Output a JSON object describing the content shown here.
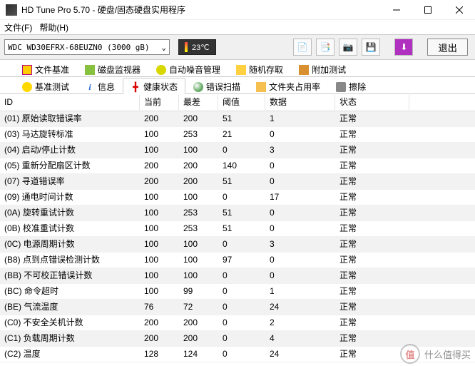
{
  "window": {
    "title": "HD Tune Pro 5.70 - 硬盘/固态硬盘实用程序"
  },
  "menus": {
    "file": "文件(F)",
    "help": "帮助(H)"
  },
  "toolbar": {
    "drive": "WDC WD30EFRX-68EUZN0 (3000 gB)",
    "temp": "23℃",
    "exit": "退出"
  },
  "tabs_row1": [
    {
      "label": "文件基准",
      "icon": "i-file"
    },
    {
      "label": "磁盘监视器",
      "icon": "i-chart"
    },
    {
      "label": "自动噪音管理",
      "icon": "i-speaker"
    },
    {
      "label": "随机存取",
      "icon": "i-card"
    },
    {
      "label": "附加测试",
      "icon": "i-clip"
    }
  ],
  "tabs_row2": [
    {
      "label": "基准测试",
      "icon": "i-bench"
    },
    {
      "label": "信息",
      "icon": "i-info",
      "glyph": "i"
    },
    {
      "label": "健康状态",
      "icon": "i-health",
      "glyph": "╋",
      "active": true
    },
    {
      "label": "错误扫描",
      "icon": "i-scan"
    },
    {
      "label": "文件夹占用率",
      "icon": "i-folder"
    },
    {
      "label": "擦除",
      "icon": "i-erase"
    }
  ],
  "columns": [
    "ID",
    "当前",
    "最差",
    "阈值",
    "数据",
    "状态"
  ],
  "rows": [
    {
      "id": "(01) 原始读取错误率",
      "cur": "200",
      "worst": "200",
      "thr": "51",
      "data": "1",
      "stat": "正常"
    },
    {
      "id": "(03) 马达旋转标准",
      "cur": "100",
      "worst": "253",
      "thr": "21",
      "data": "0",
      "stat": "正常"
    },
    {
      "id": "(04) 启动/停止计数",
      "cur": "100",
      "worst": "100",
      "thr": "0",
      "data": "3",
      "stat": "正常"
    },
    {
      "id": "(05) 重新分配扇区计数",
      "cur": "200",
      "worst": "200",
      "thr": "140",
      "data": "0",
      "stat": "正常"
    },
    {
      "id": "(07) 寻道错误率",
      "cur": "200",
      "worst": "200",
      "thr": "51",
      "data": "0",
      "stat": "正常"
    },
    {
      "id": "(09) 通电时间计数",
      "cur": "100",
      "worst": "100",
      "thr": "0",
      "data": "17",
      "stat": "正常"
    },
    {
      "id": "(0A) 旋转重试计数",
      "cur": "100",
      "worst": "253",
      "thr": "51",
      "data": "0",
      "stat": "正常"
    },
    {
      "id": "(0B) 校准重试计数",
      "cur": "100",
      "worst": "253",
      "thr": "51",
      "data": "0",
      "stat": "正常"
    },
    {
      "id": "(0C) 电源周期计数",
      "cur": "100",
      "worst": "100",
      "thr": "0",
      "data": "3",
      "stat": "正常"
    },
    {
      "id": "(B8) 点到点错误检测计数",
      "cur": "100",
      "worst": "100",
      "thr": "97",
      "data": "0",
      "stat": "正常"
    },
    {
      "id": "(BB) 不可校正错误计数",
      "cur": "100",
      "worst": "100",
      "thr": "0",
      "data": "0",
      "stat": "正常"
    },
    {
      "id": "(BC) 命令超时",
      "cur": "100",
      "worst": "99",
      "thr": "0",
      "data": "1",
      "stat": "正常"
    },
    {
      "id": "(BE) 气流温度",
      "cur": "76",
      "worst": "72",
      "thr": "0",
      "data": "24",
      "stat": "正常"
    },
    {
      "id": "(C0) 不安全关机计数",
      "cur": "200",
      "worst": "200",
      "thr": "0",
      "data": "2",
      "stat": "正常"
    },
    {
      "id": "(C1) 负载周期计数",
      "cur": "200",
      "worst": "200",
      "thr": "0",
      "data": "4",
      "stat": "正常"
    },
    {
      "id": "(C2) 温度",
      "cur": "128",
      "worst": "124",
      "thr": "0",
      "data": "24",
      "stat": "正常"
    }
  ],
  "watermark": "什么值得买"
}
